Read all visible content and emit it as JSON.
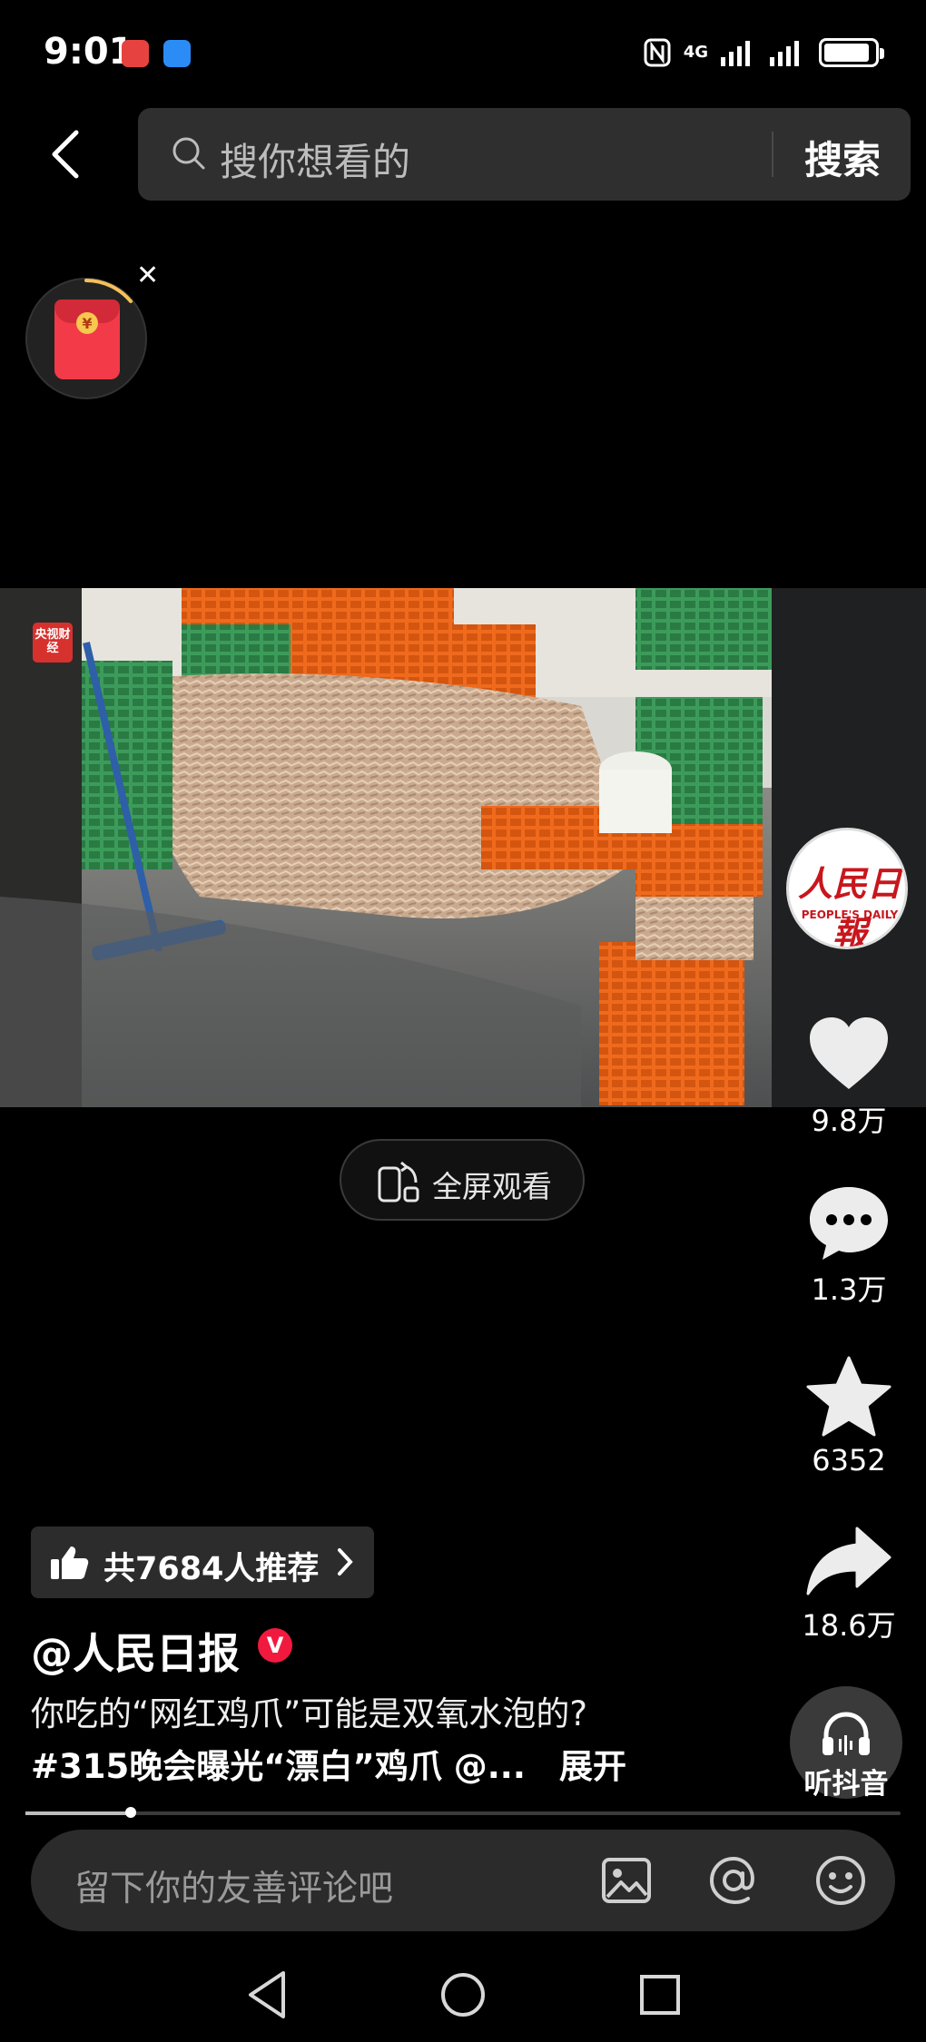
{
  "status_bar": {
    "time": "9:01",
    "network": "4G",
    "battery_level": 0.9
  },
  "search": {
    "placeholder": "搜你想看的",
    "button_label": "搜索"
  },
  "video": {
    "watermark": "央视财经",
    "fullscreen_label": "全屏观看"
  },
  "account": {
    "avatar_text": "人民日報",
    "avatar_subtext": "PEOPLE'S DAILY"
  },
  "actions": {
    "likes": "9.8万",
    "comments": "1.3万",
    "favorites": "6352",
    "shares": "18.6万",
    "listen_label": "听抖音"
  },
  "post": {
    "recommend_label": "共7684人推荐",
    "author": "@人民日报",
    "verified_mark": "V",
    "caption_line1": "你吃的“网红鸡爪”可能是双氧水泡的?",
    "caption_line2": "#315晚会曝光“漂白”鸡爪 @...",
    "expand_label": "展开",
    "progress": 0.12
  },
  "comment": {
    "placeholder": "留下你的友善评论吧"
  },
  "colors": {
    "accent_red": "#f2193f",
    "brand_red": "#c8161d",
    "background": "#000000"
  }
}
